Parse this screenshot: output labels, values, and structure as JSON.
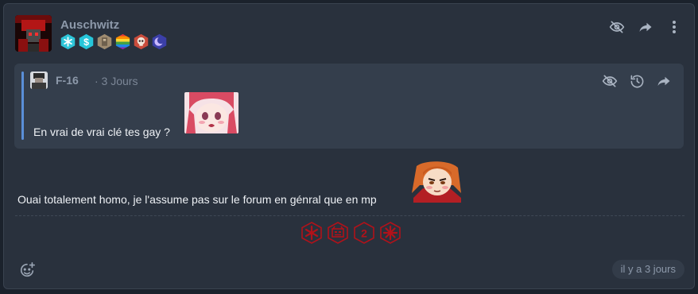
{
  "post": {
    "author": "Auschwitz",
    "timestamp": "il y a 3 jours",
    "body_text": "Ouai totalement homo, je l'assume pas sur le forum en génral que en mp"
  },
  "badges": [
    {
      "name": "snowflake-badge",
      "color": "#2ec5d8"
    },
    {
      "name": "dollar-badge",
      "color": "#26c6da"
    },
    {
      "name": "stone-badge",
      "color": "#9e8b70"
    },
    {
      "name": "rainbow-badge",
      "color": "#e85c4a"
    },
    {
      "name": "skull-badge",
      "color": "#c94c3c"
    },
    {
      "name": "moon-badge",
      "color": "#5b5fd4"
    }
  ],
  "quote": {
    "author": "F-16",
    "time": "· 3 Jours",
    "text": "En vrai de vrai clé tes gay ?"
  },
  "reactions": [
    {
      "name": "reaction-snowflake",
      "label": ""
    },
    {
      "name": "reaction-devil",
      "label": ""
    },
    {
      "name": "reaction-number",
      "label": "2"
    },
    {
      "name": "reaction-star",
      "label": ""
    }
  ],
  "colors": {
    "accent_quote_bar": "#5a8fd8",
    "reaction_red": "#b0121a",
    "muted_text": "#8d99aa"
  },
  "icons": {
    "hide": "eye-off-icon",
    "share": "share-icon",
    "menu": "more-vertical-icon",
    "history": "history-icon",
    "emoji": "emoji-add-icon"
  }
}
